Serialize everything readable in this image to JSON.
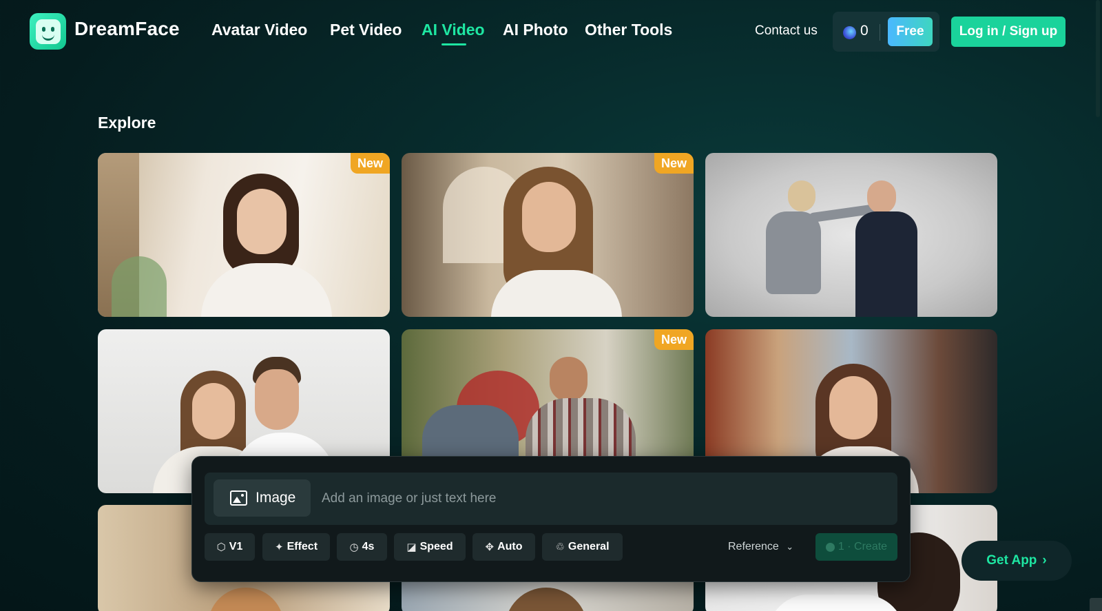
{
  "header": {
    "brand": "DreamFace",
    "nav": [
      "Avatar Video",
      "Pet Video",
      "AI Video",
      "AI Photo",
      "Other Tools"
    ],
    "active_nav": "AI Video",
    "contact": "Contact us",
    "credits": "0",
    "free_label": "Free",
    "login_label": "Log in / Sign up"
  },
  "explore": {
    "title": "Explore",
    "badge_label": "New",
    "cards": [
      {
        "subject": "woman-sitting-indoors",
        "badge": true
      },
      {
        "subject": "woman-in-arcade",
        "badge": true
      },
      {
        "subject": "two-people-fighting",
        "badge": false
      },
      {
        "subject": "couple-portrait",
        "badge": false
      },
      {
        "subject": "boxing-men-street",
        "badge": true
      },
      {
        "subject": "woman-in-market-street",
        "badge": false
      }
    ]
  },
  "prompt": {
    "image_label": "Image",
    "placeholder": "Add an image or just text here",
    "options": [
      "V1",
      "Effect",
      "4s",
      "Speed",
      "Auto",
      "General"
    ],
    "reference_label": "Reference",
    "create_label": "1 · Create"
  },
  "get_app": "Get App"
}
